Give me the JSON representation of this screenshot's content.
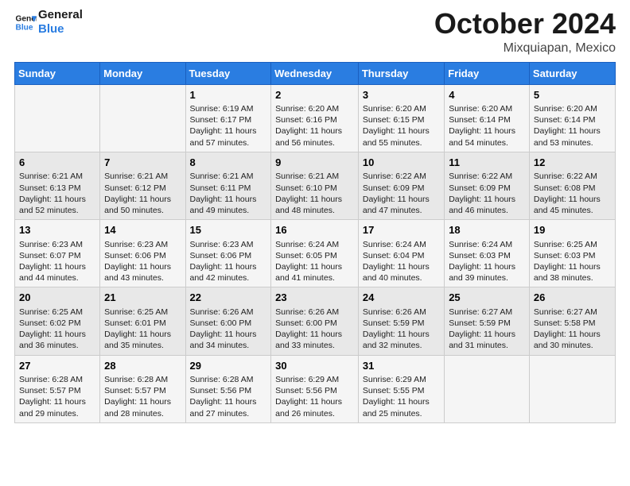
{
  "header": {
    "logo_line1": "General",
    "logo_line2": "Blue",
    "month": "October 2024",
    "location": "Mixquiapan, Mexico"
  },
  "days_of_week": [
    "Sunday",
    "Monday",
    "Tuesday",
    "Wednesday",
    "Thursday",
    "Friday",
    "Saturday"
  ],
  "weeks": [
    [
      {
        "day": "",
        "info": ""
      },
      {
        "day": "",
        "info": ""
      },
      {
        "day": "1",
        "info": "Sunrise: 6:19 AM\nSunset: 6:17 PM\nDaylight: 11 hours and 57 minutes."
      },
      {
        "day": "2",
        "info": "Sunrise: 6:20 AM\nSunset: 6:16 PM\nDaylight: 11 hours and 56 minutes."
      },
      {
        "day": "3",
        "info": "Sunrise: 6:20 AM\nSunset: 6:15 PM\nDaylight: 11 hours and 55 minutes."
      },
      {
        "day": "4",
        "info": "Sunrise: 6:20 AM\nSunset: 6:14 PM\nDaylight: 11 hours and 54 minutes."
      },
      {
        "day": "5",
        "info": "Sunrise: 6:20 AM\nSunset: 6:14 PM\nDaylight: 11 hours and 53 minutes."
      }
    ],
    [
      {
        "day": "6",
        "info": "Sunrise: 6:21 AM\nSunset: 6:13 PM\nDaylight: 11 hours and 52 minutes."
      },
      {
        "day": "7",
        "info": "Sunrise: 6:21 AM\nSunset: 6:12 PM\nDaylight: 11 hours and 50 minutes."
      },
      {
        "day": "8",
        "info": "Sunrise: 6:21 AM\nSunset: 6:11 PM\nDaylight: 11 hours and 49 minutes."
      },
      {
        "day": "9",
        "info": "Sunrise: 6:21 AM\nSunset: 6:10 PM\nDaylight: 11 hours and 48 minutes."
      },
      {
        "day": "10",
        "info": "Sunrise: 6:22 AM\nSunset: 6:09 PM\nDaylight: 11 hours and 47 minutes."
      },
      {
        "day": "11",
        "info": "Sunrise: 6:22 AM\nSunset: 6:09 PM\nDaylight: 11 hours and 46 minutes."
      },
      {
        "day": "12",
        "info": "Sunrise: 6:22 AM\nSunset: 6:08 PM\nDaylight: 11 hours and 45 minutes."
      }
    ],
    [
      {
        "day": "13",
        "info": "Sunrise: 6:23 AM\nSunset: 6:07 PM\nDaylight: 11 hours and 44 minutes."
      },
      {
        "day": "14",
        "info": "Sunrise: 6:23 AM\nSunset: 6:06 PM\nDaylight: 11 hours and 43 minutes."
      },
      {
        "day": "15",
        "info": "Sunrise: 6:23 AM\nSunset: 6:06 PM\nDaylight: 11 hours and 42 minutes."
      },
      {
        "day": "16",
        "info": "Sunrise: 6:24 AM\nSunset: 6:05 PM\nDaylight: 11 hours and 41 minutes."
      },
      {
        "day": "17",
        "info": "Sunrise: 6:24 AM\nSunset: 6:04 PM\nDaylight: 11 hours and 40 minutes."
      },
      {
        "day": "18",
        "info": "Sunrise: 6:24 AM\nSunset: 6:03 PM\nDaylight: 11 hours and 39 minutes."
      },
      {
        "day": "19",
        "info": "Sunrise: 6:25 AM\nSunset: 6:03 PM\nDaylight: 11 hours and 38 minutes."
      }
    ],
    [
      {
        "day": "20",
        "info": "Sunrise: 6:25 AM\nSunset: 6:02 PM\nDaylight: 11 hours and 36 minutes."
      },
      {
        "day": "21",
        "info": "Sunrise: 6:25 AM\nSunset: 6:01 PM\nDaylight: 11 hours and 35 minutes."
      },
      {
        "day": "22",
        "info": "Sunrise: 6:26 AM\nSunset: 6:00 PM\nDaylight: 11 hours and 34 minutes."
      },
      {
        "day": "23",
        "info": "Sunrise: 6:26 AM\nSunset: 6:00 PM\nDaylight: 11 hours and 33 minutes."
      },
      {
        "day": "24",
        "info": "Sunrise: 6:26 AM\nSunset: 5:59 PM\nDaylight: 11 hours and 32 minutes."
      },
      {
        "day": "25",
        "info": "Sunrise: 6:27 AM\nSunset: 5:59 PM\nDaylight: 11 hours and 31 minutes."
      },
      {
        "day": "26",
        "info": "Sunrise: 6:27 AM\nSunset: 5:58 PM\nDaylight: 11 hours and 30 minutes."
      }
    ],
    [
      {
        "day": "27",
        "info": "Sunrise: 6:28 AM\nSunset: 5:57 PM\nDaylight: 11 hours and 29 minutes."
      },
      {
        "day": "28",
        "info": "Sunrise: 6:28 AM\nSunset: 5:57 PM\nDaylight: 11 hours and 28 minutes."
      },
      {
        "day": "29",
        "info": "Sunrise: 6:28 AM\nSunset: 5:56 PM\nDaylight: 11 hours and 27 minutes."
      },
      {
        "day": "30",
        "info": "Sunrise: 6:29 AM\nSunset: 5:56 PM\nDaylight: 11 hours and 26 minutes."
      },
      {
        "day": "31",
        "info": "Sunrise: 6:29 AM\nSunset: 5:55 PM\nDaylight: 11 hours and 25 minutes."
      },
      {
        "day": "",
        "info": ""
      },
      {
        "day": "",
        "info": ""
      }
    ]
  ]
}
